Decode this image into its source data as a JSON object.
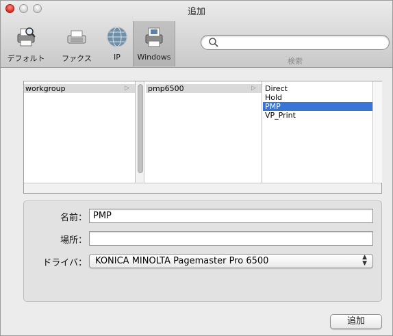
{
  "window": {
    "title": "追加"
  },
  "toolbar": {
    "items": [
      {
        "label": "デフォルト",
        "icon": "printer-search-icon"
      },
      {
        "label": "ファクス",
        "icon": "fax-icon"
      },
      {
        "label": "IP",
        "icon": "globe-icon"
      },
      {
        "label": "Windows",
        "icon": "windows-printer-icon"
      }
    ],
    "selected": "Windows",
    "search": {
      "placeholder": "",
      "caption": "検索"
    }
  },
  "browser": {
    "column1": [
      {
        "label": "workgroup",
        "state": "selected-inactive"
      }
    ],
    "column2": [
      {
        "label": "pmp6500",
        "state": "selected-inactive"
      }
    ],
    "column3": [
      {
        "label": "Direct",
        "state": "normal"
      },
      {
        "label": "Hold",
        "state": "normal"
      },
      {
        "label": "PMP",
        "state": "selected"
      },
      {
        "label": "VP_Print",
        "state": "normal"
      }
    ]
  },
  "form": {
    "name_label": "名前：",
    "name_value": "PMP",
    "location_label": "場所：",
    "location_value": "",
    "driver_label": "ドライバ：",
    "driver_value": "KONICA MINOLTA Pagemaster Pro 6500"
  },
  "footer": {
    "add_button": "追加"
  },
  "colors": {
    "selection": "#3875d7",
    "close": "#d8291b"
  }
}
